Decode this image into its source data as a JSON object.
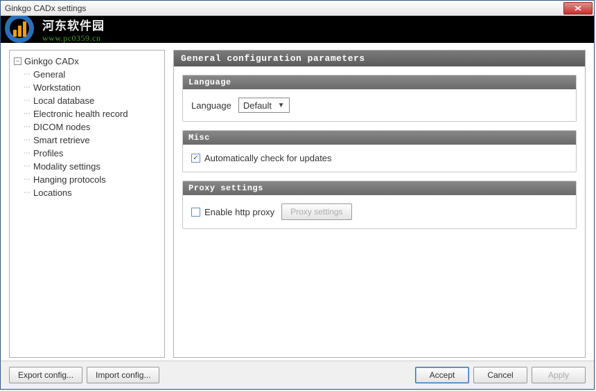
{
  "window": {
    "title": "Ginkgo CADx settings"
  },
  "banner": {
    "chinese": "河东软件园",
    "url": "www.pc0359.cn"
  },
  "sidebar": {
    "root_label": "Ginkgo CADx",
    "items": [
      {
        "label": "General"
      },
      {
        "label": "Workstation"
      },
      {
        "label": "Local database"
      },
      {
        "label": "Electronic health record"
      },
      {
        "label": "DICOM nodes"
      },
      {
        "label": "Smart retrieve"
      },
      {
        "label": "Profiles"
      },
      {
        "label": "Modality settings"
      },
      {
        "label": "Hanging protocols"
      },
      {
        "label": "Locations"
      }
    ]
  },
  "content": {
    "header": "General configuration parameters",
    "language_section": {
      "title": "Language",
      "label": "Language",
      "value": "Default"
    },
    "misc_section": {
      "title": "Misc",
      "auto_update_label": "Automatically check for updates",
      "auto_update_checked": true
    },
    "proxy_section": {
      "title": "Proxy settings",
      "enable_label": "Enable http proxy",
      "enable_checked": false,
      "proxy_button": "Proxy settings"
    }
  },
  "footer": {
    "export": "Export config...",
    "import": "Import config...",
    "accept": "Accept",
    "cancel": "Cancel",
    "apply": "Apply"
  }
}
